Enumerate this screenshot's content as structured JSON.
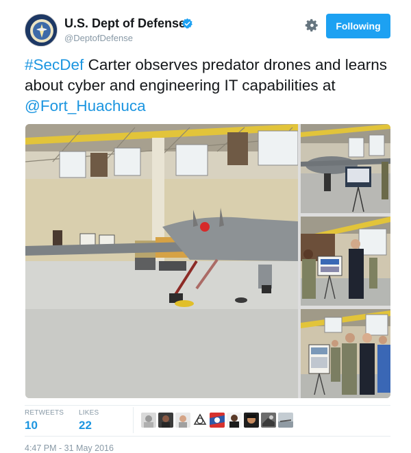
{
  "account": {
    "display_name": "U.S. Dept of Defense",
    "handle": "@DeptofDefense",
    "verified": true,
    "avatar_icon": "dod-seal-icon"
  },
  "actions": {
    "follow_label": "Following",
    "settings_icon": "gear-icon"
  },
  "tweet": {
    "hashtag": "#SecDef",
    "text_middle": " Carter observes predator drones and learns about cyber and engineering IT capabilities at ",
    "mention": "@Fort_Huachuca"
  },
  "media": {
    "photos": [
      {
        "description_icon": "hangar-predator-drone-photo"
      },
      {
        "description_icon": "drone-in-hangar-photo"
      },
      {
        "description_icon": "briefing-poster-photo"
      },
      {
        "description_icon": "group-briefing-photo"
      }
    ]
  },
  "stats": {
    "retweets_label": "RETWEETS",
    "retweets_value": "10",
    "likes_label": "LIKES",
    "likes_value": "22"
  },
  "likers_count_shown": 9,
  "timestamp": "4:47 PM - 31 May 2016",
  "colors": {
    "accent": "#1da1f2",
    "link": "#1b95e0",
    "muted": "#8899a6"
  }
}
